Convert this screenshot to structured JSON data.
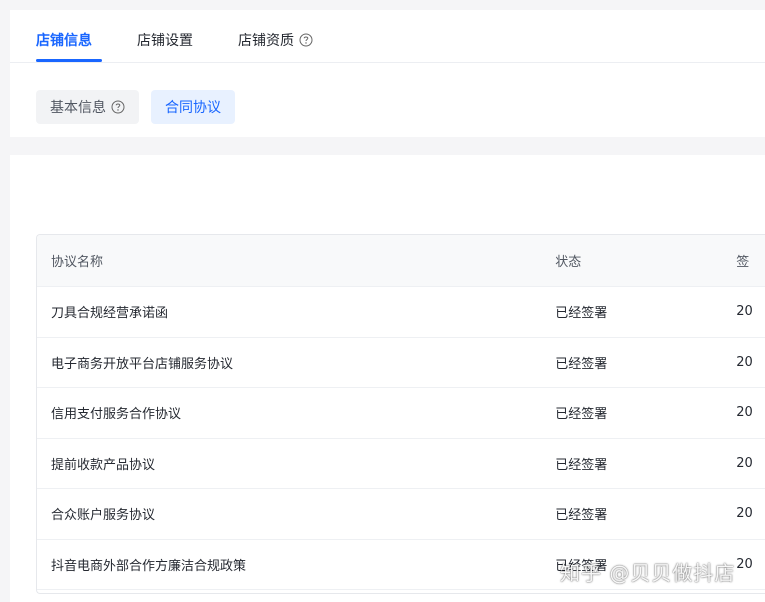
{
  "tabs": [
    {
      "label": "店铺信息",
      "active": true
    },
    {
      "label": "店铺设置",
      "active": false
    },
    {
      "label": "店铺资质",
      "active": false,
      "has_help": true
    }
  ],
  "subtabs": [
    {
      "label": "基本信息",
      "active": false,
      "has_help": true
    },
    {
      "label": "合同协议",
      "active": true
    }
  ],
  "table": {
    "columns": [
      "协议名称",
      "状态",
      "签"
    ],
    "rows": [
      {
        "name": "刀具合规经营承诺函",
        "status": "已经签署",
        "date": "20"
      },
      {
        "name": "电子商务开放平台店铺服务协议",
        "status": "已经签署",
        "date": "20"
      },
      {
        "name": "信用支付服务合作协议",
        "status": "已经签署",
        "date": "20"
      },
      {
        "name": "提前收款产品协议",
        "status": "已经签署",
        "date": "20"
      },
      {
        "name": "合众账户服务协议",
        "status": "已经签署",
        "date": "20"
      },
      {
        "name": "抖音电商外部合作方廉洁合规政策",
        "status": "已经签署",
        "date": "20"
      }
    ]
  },
  "watermark": "知乎 @贝贝做抖店",
  "colors": {
    "accent": "#1966ff",
    "accent_bg": "#e8f1ff",
    "border": "#e6e8ec"
  }
}
